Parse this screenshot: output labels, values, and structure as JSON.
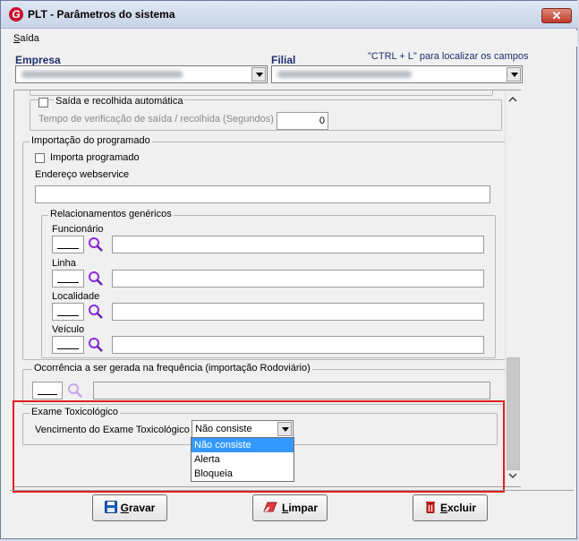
{
  "window": {
    "title": "PLT - Parâmetros do sistema",
    "app_icon": "G"
  },
  "menu": {
    "saida": "Saída",
    "saida_prefix": "S",
    "saida_rest": "aída"
  },
  "header": {
    "empresa_label": "Empresa",
    "filial_label": "Filial",
    "hint": "\"CTRL + L\" para localizar os campos"
  },
  "saida": {
    "auto_label": "Saída e recolhida automática",
    "tempo_label": "Tempo de verificação de saída / recolhida (Segundos)",
    "tempo_value": "0"
  },
  "importacao": {
    "group_title": "Importação do programado",
    "importa_label": "Importa programado",
    "endereco_label": "Endereço webservice",
    "relac_title": "Relacionamentos genéricos",
    "funcionario_label": "Funcionário",
    "linha_label": "Linha",
    "localidade_label": "Localidade",
    "veiculo_label": "Veículo"
  },
  "ocorrencia": {
    "label": "Ocorrência a ser gerada na frequência (importação Rodoviário)"
  },
  "exame": {
    "group_title": "Exame Toxicológico",
    "vencimento_label": "Vencimento do Exame Toxicológico",
    "selected": "Não consiste",
    "options": [
      "Não consiste",
      "Alerta",
      "Bloqueia"
    ]
  },
  "buttons": {
    "gravar_first": "G",
    "gravar_rest": "ravar",
    "limpar_first": "L",
    "limpar_rest": "impar",
    "excluir_first": "E",
    "excluir_rest": "xcluir"
  }
}
